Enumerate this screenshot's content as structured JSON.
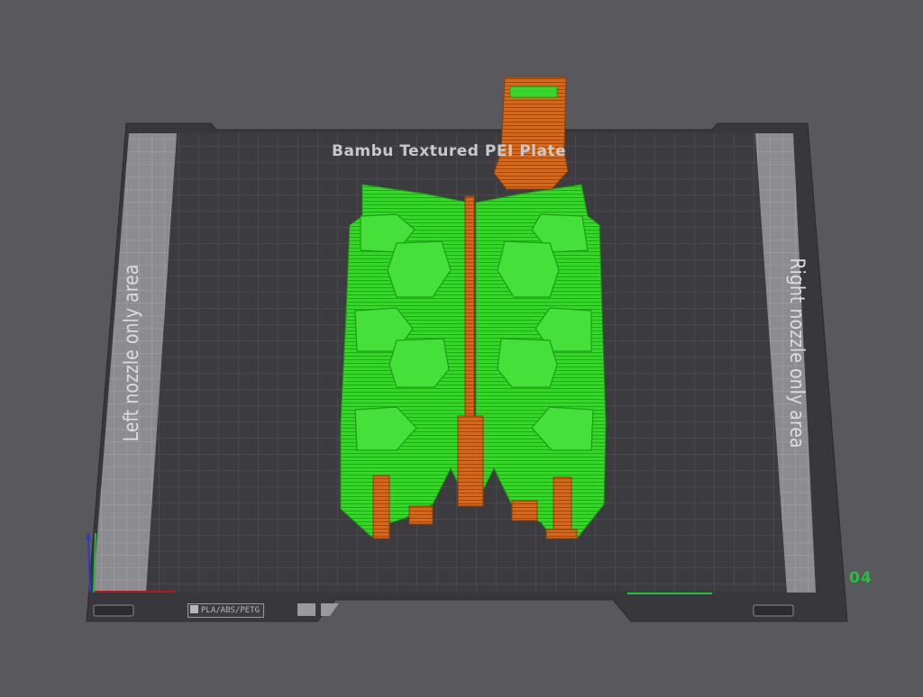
{
  "viewport": {
    "background": "#58585d"
  },
  "plate": {
    "title": "Bambu Textured PEI Plate",
    "left_label": "Left nozzle only area",
    "right_label": "Right nozzle only area",
    "badge": "PLA/ABS/PETG",
    "plate_number": "04",
    "colors": {
      "frame": "#38383c",
      "surface": "#3b3b40",
      "grid": "#55555a",
      "nozzle_zone": "#8a8a8e"
    }
  },
  "model": {
    "primary_color": "#37d42c",
    "support_color": "#d2691e"
  },
  "axes": {
    "x_color": "#c0141e",
    "y_color": "#22b33a",
    "z_color": "#2a3cc8"
  }
}
